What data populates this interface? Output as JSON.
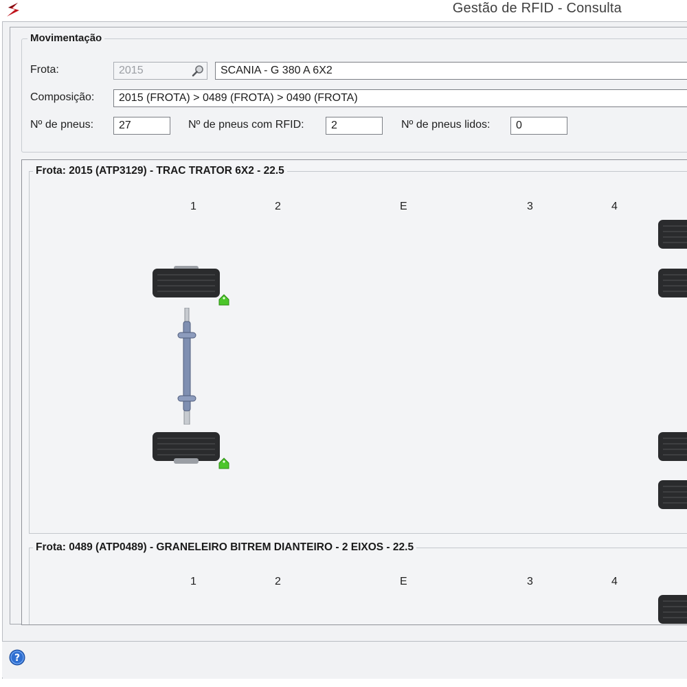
{
  "window": {
    "title": "Gestão de RFID - Consulta",
    "logo_icon": "app-logo-icon",
    "accent_color": "#c0141c"
  },
  "movimentacao": {
    "group_title": "Movimentação",
    "frota_label": "Frota:",
    "frota_value": "2015",
    "frota_description": "SCANIA - G 380 A 6X2",
    "composicao_label": "Composição:",
    "composicao_value": "2015 (FROTA) > 0489 (FROTA) > 0490 (FROTA)",
    "n_pneus_label": "Nº de pneus:",
    "n_pneus_value": "27",
    "n_pneus_rfid_label": "Nº de pneus com RFID:",
    "n_pneus_rfid_value": "2",
    "n_pneus_lidos_label": "Nº de pneus lidos:",
    "n_pneus_lidos_value": "0"
  },
  "vehicles": [
    {
      "title": "Frota: 2015 (ATP3129) - TRAC TRATOR 6X2 - 22.5",
      "positions": [
        "1",
        "2",
        "E",
        "3",
        "4"
      ]
    },
    {
      "title": "Frota: 0489 (ATP0489) - GRANELEIRO BITREM DIANTEIRO - 2 EIXOS - 22.5",
      "positions": [
        "1",
        "2",
        "E",
        "3",
        "4"
      ]
    }
  ],
  "colors": {
    "rfid_tag": "#4cc62a",
    "tire": "#2b2b2b",
    "help": "#2f6fd1"
  },
  "statusbar": {
    "help_icon": "help-icon"
  }
}
